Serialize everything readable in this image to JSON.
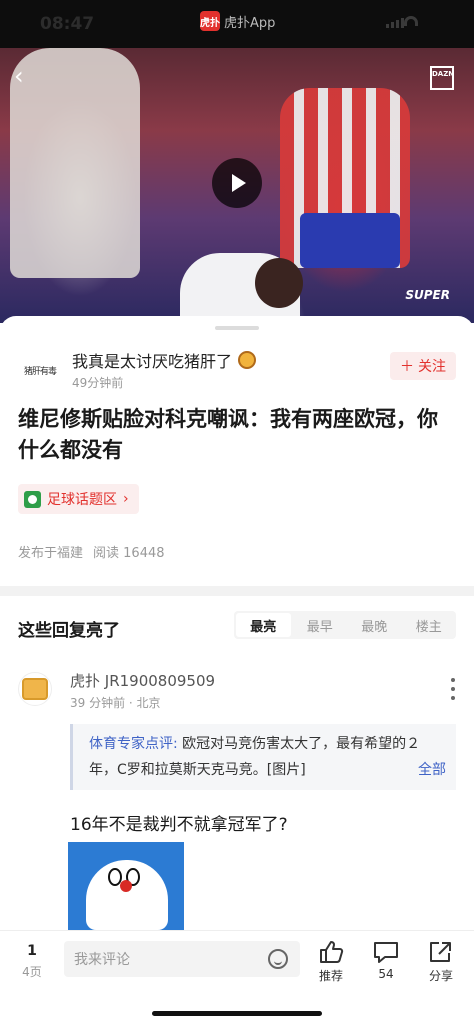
{
  "status_bar": {
    "time": "08:47",
    "app_name": "虎扑App",
    "app_logo_text": "虎扑"
  },
  "video": {
    "brand_label": "DAZN",
    "broadcast_label": "SUPER"
  },
  "post": {
    "author": "我真是太讨厌吃猪肝了",
    "author_avatar_text": "猪肝有毒",
    "time": "49分钟前",
    "follow_label": "关注",
    "title": "维尼修斯贴脸对科克嘲讽：我有两座欧冠，你什么都没有",
    "topic_label": "足球话题区",
    "location": "发布于福建",
    "reads": "阅读 16448"
  },
  "replies": {
    "section_title": "这些回复亮了",
    "sort_tabs": [
      "最亮",
      "最早",
      "最晚",
      "楼主"
    ],
    "active_tab": "最亮"
  },
  "comment": {
    "user": "虎扑 JR1900809509",
    "meta": "39 分钟前 · 北京",
    "expert_tag": "体育专家点评:",
    "expert_text": " 欧冠对马竞伤害太大了，最有希望的２年，C罗和拉莫斯天克马竞。[图片]",
    "expert_more": "全部",
    "body": "16年不是裁判不就拿冠军了?"
  },
  "bottom_bar": {
    "current_page": "1",
    "total_pages": "4页",
    "comment_placeholder": "我来评论",
    "like_label": "推荐",
    "comment_count": "54",
    "share_label": "分享"
  },
  "colors": {
    "accent": "#e2312d",
    "link": "#3f63c6"
  }
}
